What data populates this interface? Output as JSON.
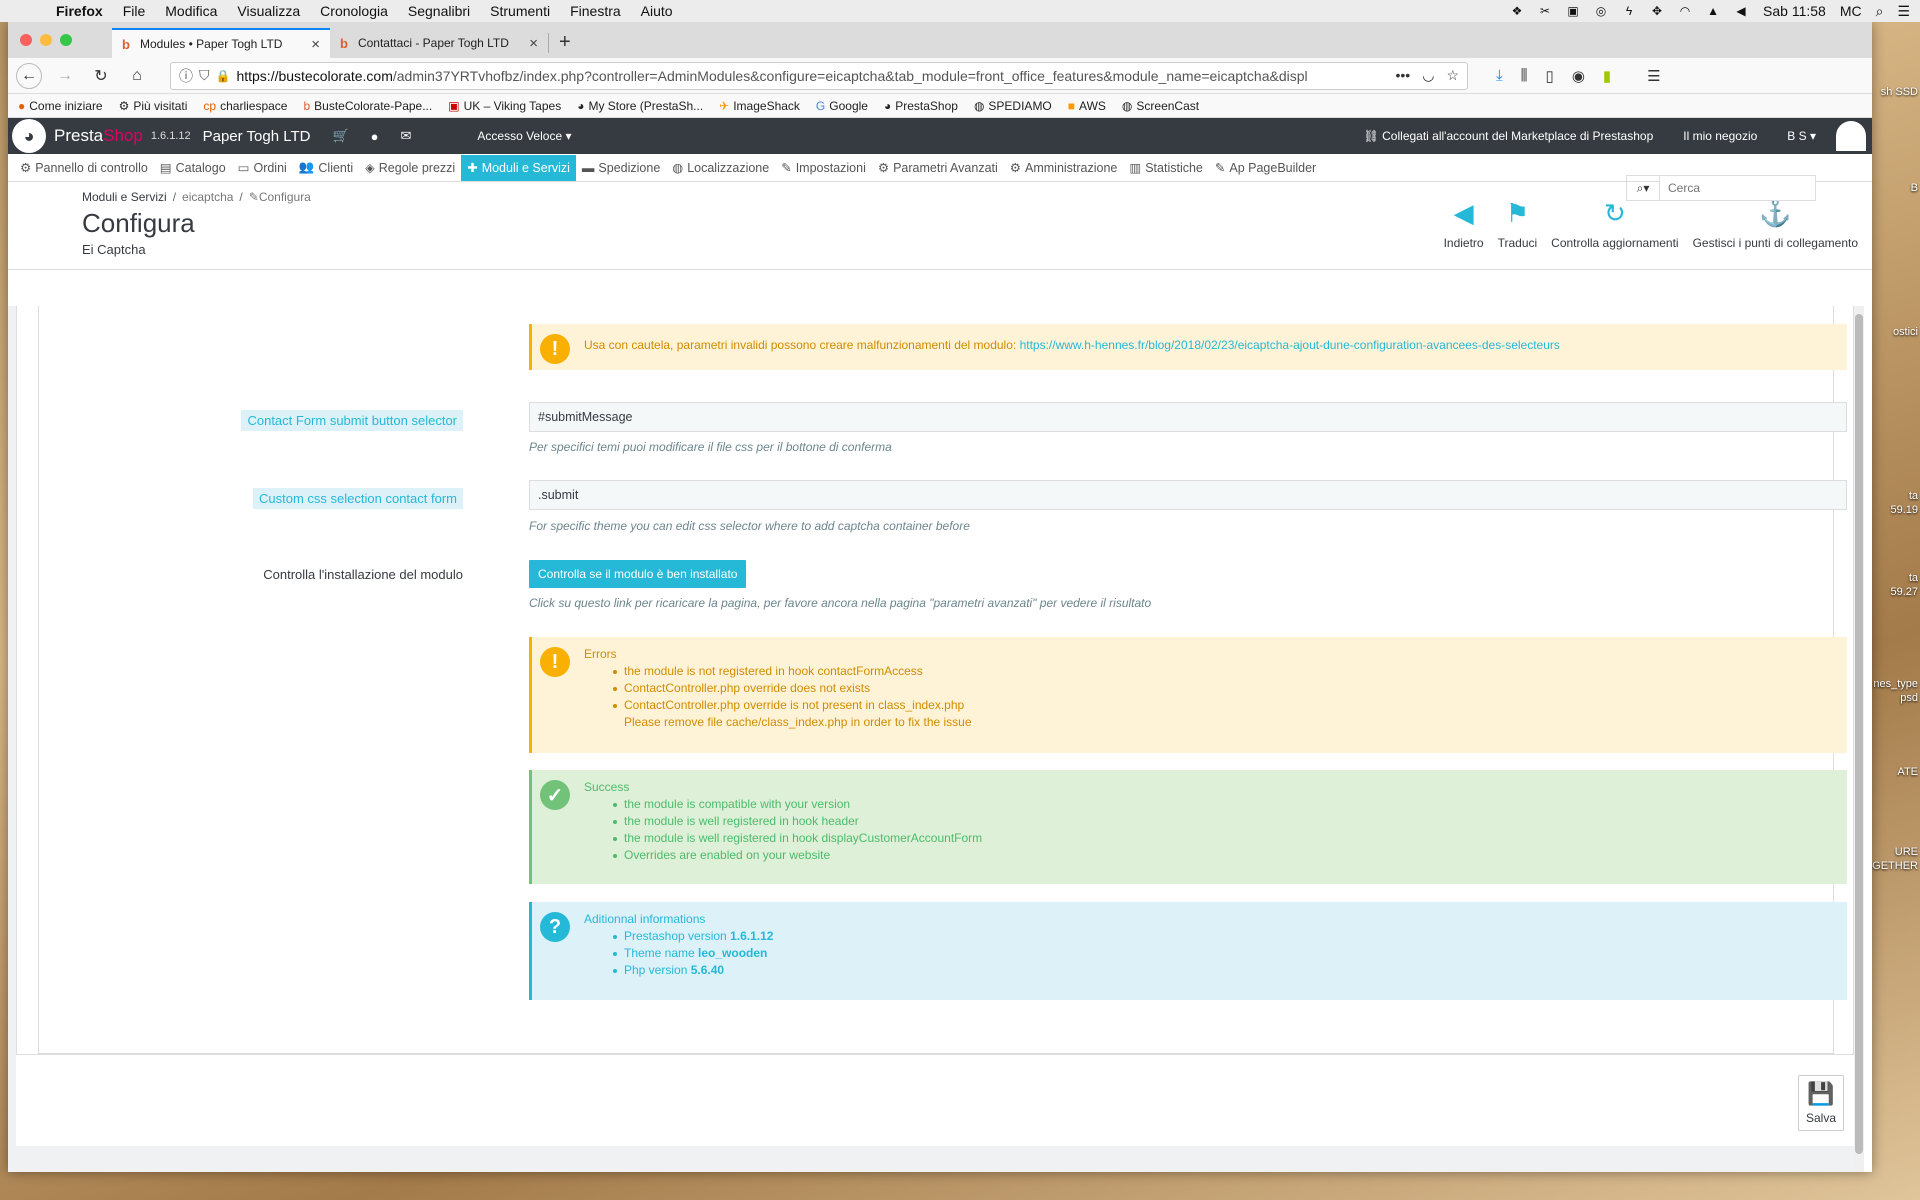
{
  "mac_menubar": {
    "app": "Firefox",
    "items": [
      "File",
      "Modifica",
      "Visualizza",
      "Cronologia",
      "Segnalibri",
      "Strumenti",
      "Finestra",
      "Aiuto"
    ],
    "clock": "Sab 11:58",
    "user": "MC"
  },
  "desktop_labels": [
    "sh SSD",
    "B",
    "ostici",
    "ta",
    "59.19",
    "ta",
    "59.27",
    "nes_type",
    "psd",
    "ATE",
    "URE",
    "GETHER"
  ],
  "browser": {
    "tabs": [
      {
        "title": "Modules • Paper Togh LTD",
        "active": true
      },
      {
        "title": "Contattaci - Paper Togh LTD",
        "active": false
      }
    ],
    "url_host": "https://bustecolorate.com",
    "url_path": "/admin37YRTvhofbz/index.php?controller=AdminModules&configure=eicaptcha&tab_module=front_office_features&module_name=eicaptcha&displ",
    "bookmarks": [
      "Come iniziare",
      "Più visitati",
      "charliespace",
      "BusteColorate-Pape...",
      "UK – Viking Tapes",
      "My Store (PrestaSh...",
      "ImageShack",
      "Google",
      "PrestaShop",
      "SPEDIAMO",
      "AWS",
      "ScreenCast"
    ]
  },
  "ps_header": {
    "brand_a": "Presta",
    "brand_b": "Shop",
    "version": "1.6.1.12",
    "shop_name": "Paper Togh LTD",
    "quick_access": "Accesso Veloce ▾",
    "marketplace": "Collegati all'account del Marketplace di Prestashop",
    "my_shop": "Il mio negozio",
    "user": "B S ▾"
  },
  "ps_menu": [
    {
      "label": "Pannello di controllo",
      "icon": "dashboard-icon",
      "glyph": "⚙",
      "active": false
    },
    {
      "label": "Catalogo",
      "icon": "catalog-icon",
      "glyph": "▤",
      "active": false
    },
    {
      "label": "Ordini",
      "icon": "orders-icon",
      "glyph": "▭",
      "active": false
    },
    {
      "label": "Clienti",
      "icon": "customers-icon",
      "glyph": "👥",
      "active": false
    },
    {
      "label": "Regole prezzi",
      "icon": "tag-icon",
      "glyph": "◈",
      "active": false
    },
    {
      "label": "Moduli e Servizi",
      "icon": "puzzle-icon",
      "glyph": "✚",
      "active": true
    },
    {
      "label": "Spedizione",
      "icon": "truck-icon",
      "glyph": "▬",
      "active": false
    },
    {
      "label": "Localizzazione",
      "icon": "globe-icon",
      "glyph": "◍",
      "active": false
    },
    {
      "label": "Impostazioni",
      "icon": "wrench-icon",
      "glyph": "✎",
      "active": false
    },
    {
      "label": "Parametri Avanzati",
      "icon": "cogs-icon",
      "glyph": "⚙",
      "active": false
    },
    {
      "label": "Amministrazione",
      "icon": "cog-icon",
      "glyph": "⚙",
      "active": false
    },
    {
      "label": "Statistiche",
      "icon": "bar-chart-icon",
      "glyph": "▥",
      "active": false
    },
    {
      "label": "Ap PageBuilder",
      "icon": "edit-icon",
      "glyph": "✎",
      "active": false
    }
  ],
  "search_placeholder": "Cerca",
  "breadcrumb": {
    "a": "Moduli e Servizi",
    "b": "eicaptcha",
    "c": "Configura"
  },
  "page": {
    "title": "Configura",
    "subtitle": "Ei Captcha"
  },
  "toolbar": [
    {
      "label": "Indietro",
      "icon": "arrow-circle-left-icon",
      "glyph": "◀"
    },
    {
      "label": "Traduci",
      "icon": "flag-icon",
      "glyph": "⚑"
    },
    {
      "label": "Controlla aggiornamenti",
      "icon": "refresh-icon",
      "glyph": "↻"
    },
    {
      "label": "Gestisci i punti di collegamento",
      "icon": "anchor-icon",
      "glyph": "⚓"
    }
  ],
  "warning_top": {
    "text": "Usa con cautela, parametri invalidi possono creare malfunzionamenti del modulo: ",
    "link": "https://www.h-hennes.fr/blog/2018/02/23/eicaptcha-ajout-dune-configuration-avancees-des-selecteurs"
  },
  "form": {
    "submit_label": "Contact Form submit button selector",
    "submit_value": "#submitMessage",
    "submit_help": "Per specifici temi puoi modificare il file css per il bottone di conferma",
    "css_label": "Custom css selection contact form",
    "css_value": ".submit",
    "css_help": "For specific theme you can edit css selector where to add captcha container before",
    "check_label": "Controlla l'installazione del modulo",
    "check_button": "Controlla se il modulo è ben installato",
    "check_help": "Click su questo link per ricaricare la pagina, per favore ancora nella pagina \"parametri avanzati\" per vedere il risultato"
  },
  "errors": {
    "title": "Errors",
    "items": [
      "the module is not registered in hook contactFormAccess",
      "ContactController.php override does not exists",
      "ContactController.php override is not present in class_index.php"
    ],
    "continuation": "Please remove file cache/class_index.php in order to fix the issue"
  },
  "success": {
    "title": "Success",
    "items": [
      "the module is compatible with your version",
      "the module is well registered in hook header",
      "the module is well registered in hook displayCustomerAccountForm",
      "Overrides are enabled on your website"
    ]
  },
  "info": {
    "title": "Aditionnal informations",
    "ps_label": "Prestashop version ",
    "ps_value": "1.6.1.12",
    "theme_label": "Theme name ",
    "theme_value": "leo_wooden",
    "php_label": "Php version ",
    "php_value": "5.6.40"
  },
  "save_label": "Salva"
}
